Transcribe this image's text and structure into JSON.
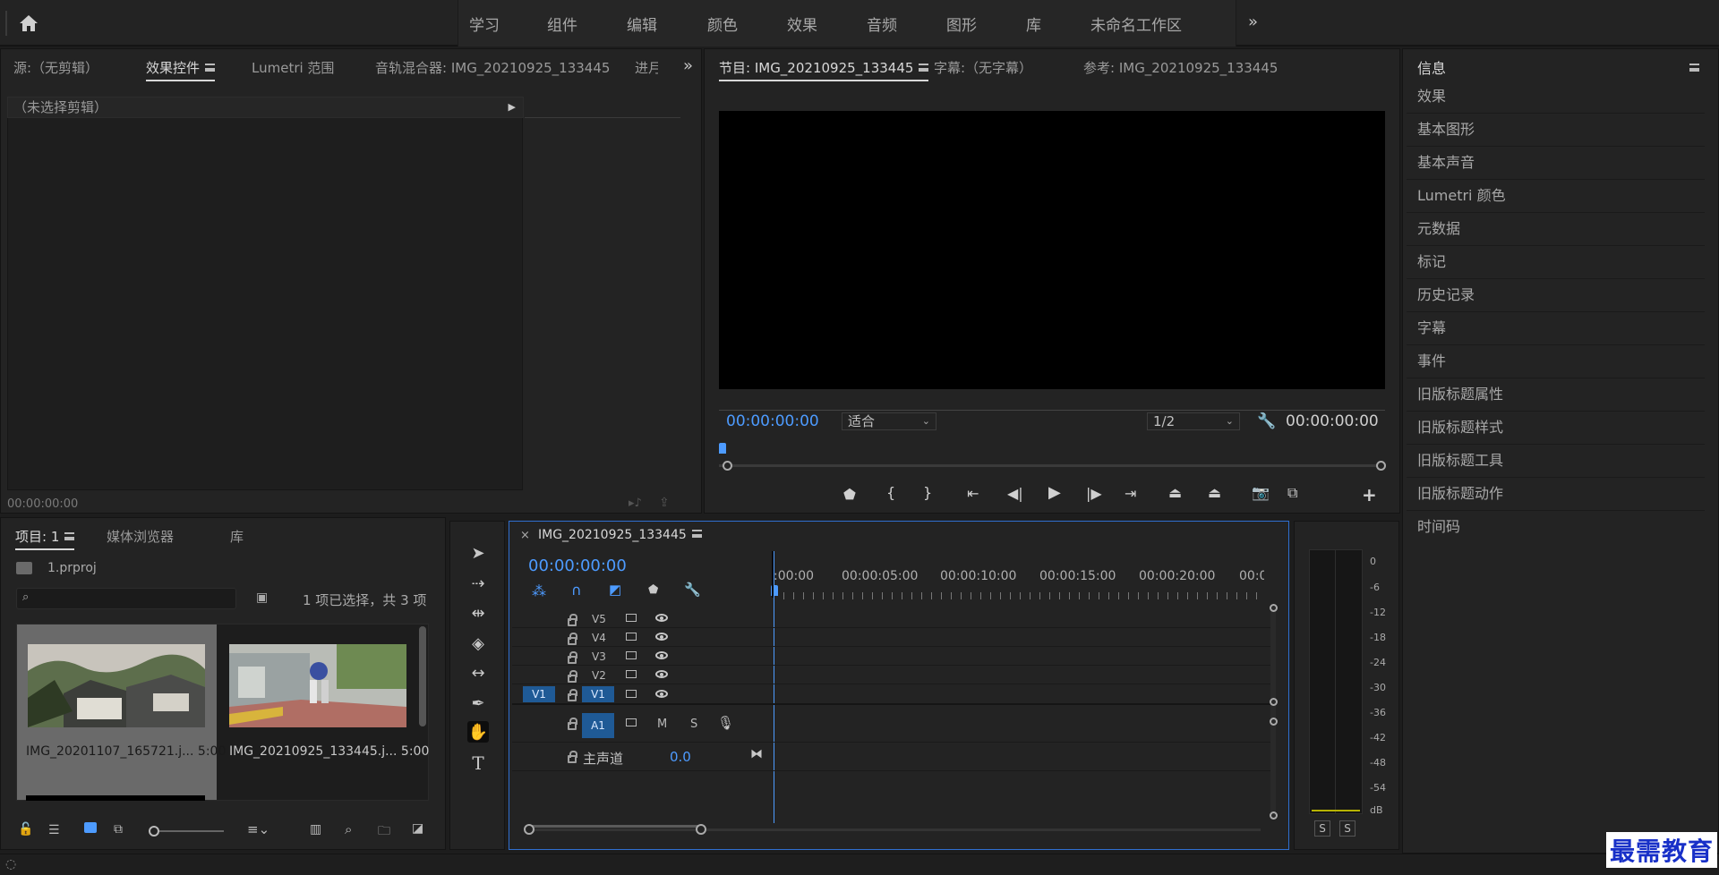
{
  "workspace": {
    "tabs": [
      "学习",
      "组件",
      "编辑",
      "颜色",
      "效果",
      "音频",
      "图形",
      "库",
      "未命名工作区"
    ]
  },
  "source_panel": {
    "tabs": [
      "源:（无剪辑）",
      "效果控件",
      "Lumetri 范围",
      "音轨混合器: IMG_20210925_133445",
      "进月"
    ],
    "active_tab": "效果控件",
    "clip_header": "（未选择剪辑）",
    "timecode": "00:00:00:00"
  },
  "program_panel": {
    "tabs": [
      "节目: IMG_20210925_133445",
      "字幕:（无字幕）",
      "参考: IMG_20210925_133445"
    ],
    "timecode_left": "00:00:00:00",
    "fit_label": "适合",
    "resolution": "1/2",
    "timecode_right": "00:00:00:00"
  },
  "info_panel": {
    "title": "信息",
    "items": [
      "效果",
      "基本图形",
      "基本声音",
      "Lumetri 颜色",
      "元数据",
      "标记",
      "历史记录",
      "字幕",
      "事件",
      "旧版标题属性",
      "旧版标题样式",
      "旧版标题工具",
      "旧版标题动作",
      "时间码"
    ]
  },
  "project_panel": {
    "tabs": [
      "项目: 1",
      "媒体浏览器",
      "库"
    ],
    "project_file": "1.prproj",
    "selection_status": "1 项已选择，共 3 项",
    "clips": [
      {
        "name": "IMG_20201107_165721.j...",
        "duration": "5:00"
      },
      {
        "name": "IMG_20210925_133445.j...",
        "duration": "5:00"
      }
    ]
  },
  "timeline": {
    "sequence_name": "IMG_20210925_133445",
    "timecode": "00:00:00:00",
    "ruler": [
      ":00:00",
      "00:00:05:00",
      "00:00:10:00",
      "00:00:15:00",
      "00:00:20:00",
      "00:0"
    ],
    "video_tracks": [
      "V5",
      "V4",
      "V3",
      "V2",
      "V1"
    ],
    "source_patch": "V1",
    "audio_track": "A1",
    "audio_buttons": {
      "mute": "M",
      "solo": "S"
    },
    "master_label": "主声道",
    "master_value": "0.0"
  },
  "audio_meter": {
    "scale": [
      "0",
      "-6",
      "-12",
      "-18",
      "-24",
      "-30",
      "-36",
      "-42",
      "-48",
      "-54",
      "dB"
    ],
    "solo_buttons": [
      "S",
      "S"
    ]
  },
  "watermark": "最需教育",
  "colors": {
    "accent_blue": "#4d9bff",
    "track_blue": "#1f5a96",
    "panel_bg": "#232323",
    "timeline_border": "#2f6fd0"
  }
}
